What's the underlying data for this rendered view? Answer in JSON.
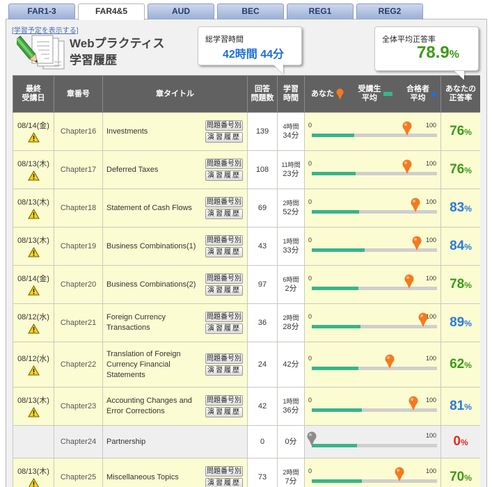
{
  "tabs": [
    {
      "label": "FAR1-3",
      "active": false
    },
    {
      "label": "FAR4&5",
      "active": true
    },
    {
      "label": "AUD",
      "active": false
    },
    {
      "label": "BEC",
      "active": false
    },
    {
      "label": "REG1",
      "active": false
    },
    {
      "label": "REG2",
      "active": false
    }
  ],
  "header": {
    "schedule_link": "[学習予定を表示する]",
    "title_line1": "Webプラクティス",
    "title_line2": "学習履歴",
    "icon": "practice-papers-pencil-icon"
  },
  "total_time": {
    "label": "総学習時間",
    "value": "42時間 44分"
  },
  "overall_rate": {
    "label": "全体平均正答率",
    "value": "78.9",
    "unit": "%"
  },
  "columns": {
    "date": "最終\n受講日",
    "chapter": "章番号",
    "title": "章タイトル",
    "count": "回答\n問題数",
    "time": "学習\n時間",
    "you": "あなた",
    "student_avg": "受講生\n平均",
    "passer_avg": "合格者\n平均",
    "rate": "あなたの\n正答率"
  },
  "row_buttons": {
    "by_question": "問題番号別",
    "history": "演習履歴"
  },
  "scale": {
    "min": "0",
    "max": "100"
  },
  "rate_unit": "%",
  "colors": {
    "my_rate_pin": "#f47a1f",
    "my_rate_pin_inactive": "#8c8c8c",
    "student_avg_bar": "#37b48d",
    "passer_avg_dot": "#1f6fe0",
    "rate_blue": "#2a7ad9",
    "rate_green": "#3c9a17",
    "rate_red": "#e8271f",
    "total_time_value": "#1d6fd6",
    "overall_rate_value": "#3c9a17"
  },
  "rows": [
    {
      "date": "08/14(金)",
      "date_icon": "warning-icon",
      "chapter": "Chapter16",
      "title": "Investments",
      "buttons": true,
      "count": "139",
      "time_h": "4時間",
      "time_m": "34分",
      "rate": 76,
      "student_avg": 34,
      "rate_color": "#3c9a17",
      "pin_color": "#f47a1f"
    },
    {
      "date": "08/13(木)",
      "date_icon": "warning-icon",
      "chapter": "Chapter17",
      "title": "Deferred Taxes",
      "buttons": true,
      "count": "108",
      "time_h": "11時間",
      "time_m": "23分",
      "rate": 76,
      "student_avg": 35,
      "rate_color": "#3c9a17",
      "pin_color": "#f47a1f"
    },
    {
      "date": "08/13(木)",
      "date_icon": "warning-icon",
      "chapter": "Chapter18",
      "title": "Statement of Cash Flows",
      "buttons": true,
      "count": "69",
      "time_h": "2時間",
      "time_m": "52分",
      "rate": 83,
      "student_avg": 38,
      "rate_color": "#2a7ad9",
      "pin_color": "#f47a1f"
    },
    {
      "date": "08/13(木)",
      "date_icon": "warning-icon",
      "chapter": "Chapter19",
      "title": "Business Combinations(1)",
      "buttons": true,
      "count": "43",
      "time_h": "1時間",
      "time_m": "33分",
      "rate": 84,
      "student_avg": 42,
      "rate_color": "#2a7ad9",
      "pin_color": "#f47a1f"
    },
    {
      "date": "08/14(金)",
      "date_icon": "warning-icon",
      "chapter": "Chapter20",
      "title": "Business Combinations(2)",
      "buttons": true,
      "count": "97",
      "time_h": "6時間",
      "time_m": "2分",
      "rate": 78,
      "student_avg": 37,
      "rate_color": "#3c9a17",
      "pin_color": "#f47a1f"
    },
    {
      "date": "08/12(水)",
      "date_icon": "warning-icon",
      "chapter": "Chapter21",
      "title": "Foreign Currency Transactions",
      "buttons": true,
      "count": "36",
      "time_h": "2時間",
      "time_m": "28分",
      "rate": 89,
      "student_avg": 39,
      "rate_color": "#2a7ad9",
      "pin_color": "#f47a1f"
    },
    {
      "date": "08/12(水)",
      "date_icon": "warning-icon",
      "chapter": "Chapter22",
      "title": "Translation of Foreign Currency Financial Statements",
      "buttons": true,
      "count": "24",
      "time_h": "",
      "time_m": "42分",
      "rate": 62,
      "student_avg": 37,
      "rate_color": "#3c9a17",
      "pin_color": "#f47a1f"
    },
    {
      "date": "08/13(木)",
      "date_icon": "warning-icon",
      "chapter": "Chapter23",
      "title": "Accounting Changes and Error Corrections",
      "buttons": true,
      "count": "42",
      "time_h": "1時間",
      "time_m": "36分",
      "rate": 81,
      "student_avg": 40,
      "rate_color": "#2a7ad9",
      "pin_color": "#f47a1f"
    },
    {
      "date": "",
      "date_icon": "",
      "chapter": "Chapter24",
      "title": "Partnership",
      "buttons": false,
      "count": "0",
      "time_h": "",
      "time_m": "0分",
      "rate": 0,
      "student_avg": 36,
      "rate_color": "#e8271f",
      "pin_color": "#8c8c8c"
    },
    {
      "date": "08/13(木)",
      "date_icon": "warning-icon",
      "chapter": "Chapter25",
      "title": "Miscellaneous Topics",
      "buttons": true,
      "count": "73",
      "time_h": "2時間",
      "time_m": "7分",
      "rate": 70,
      "student_avg": 40,
      "rate_color": "#3c9a17",
      "pin_color": "#f47a1f"
    }
  ]
}
